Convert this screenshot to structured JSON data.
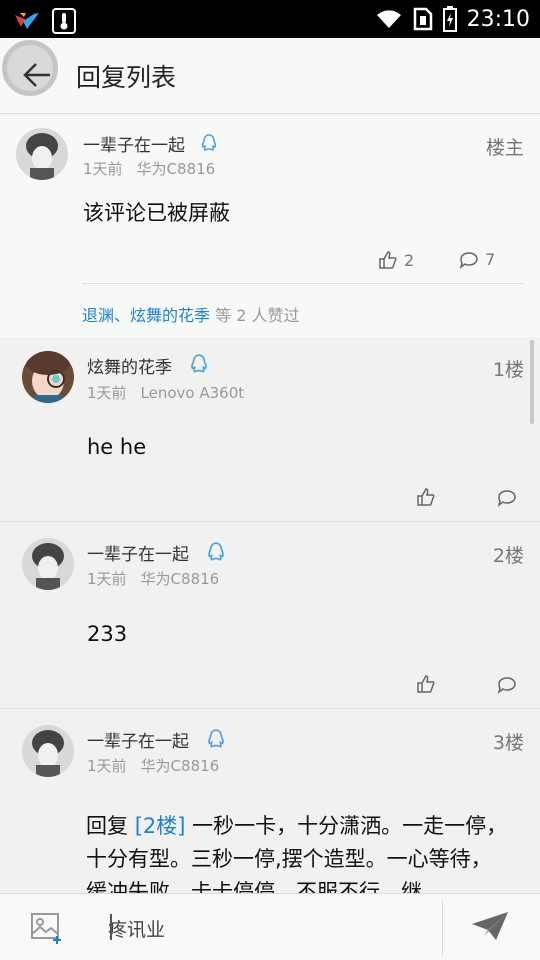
{
  "status_bar": {
    "time": "23:10"
  },
  "header": {
    "title": "回复列表"
  },
  "posts": [
    {
      "username": "一辈子在一起",
      "time_ago": "1天前",
      "device": "华为C8816",
      "floor": "楼主",
      "content": "该评论已被屏蔽",
      "like_count": "2",
      "comment_count": "7",
      "likers": [
        "退渊",
        "炫舞的花季"
      ],
      "likers_sep": "、",
      "likes_suffix": "等 2 人赞过"
    },
    {
      "username": "炫舞的花季",
      "time_ago": "1天前",
      "device": "Lenovo A360t",
      "floor": "1楼",
      "content": "he he"
    },
    {
      "username": "一辈子在一起",
      "time_ago": "1天前",
      "device": "华为C8816",
      "floor": "2楼",
      "content": "233"
    },
    {
      "username": "一辈子在一起",
      "time_ago": "1天前",
      "device": "华为C8816",
      "floor": "3楼",
      "reply_prefix": "回复",
      "reply_ref": "[2楼]",
      "content": "一秒一卡，十分潇洒。一走一停，十分有型。三秒一停,摆个造型。一心等待，缓冲失败。卡卡停停，不服不行。继"
    }
  ],
  "composer": {
    "input_value": "疼讯业"
  },
  "colors": {
    "link": "#1d82d6",
    "qq_icon": "#4aa3df"
  }
}
